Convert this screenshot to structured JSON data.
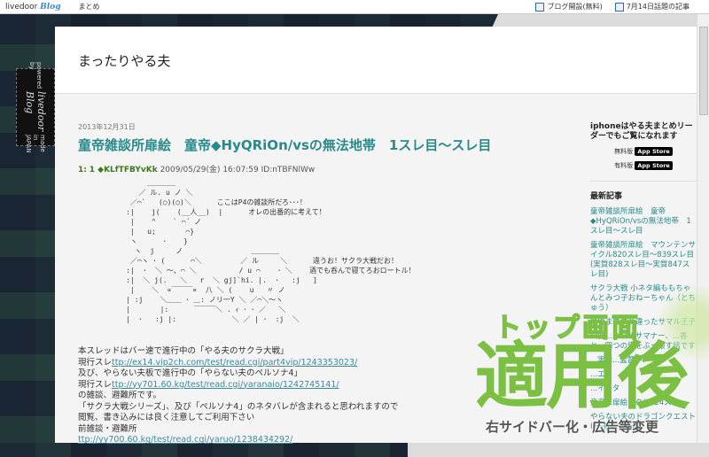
{
  "topbar": {
    "logo": "livedoor",
    "logo_blog": "Blog",
    "matome": "まとめ",
    "blog_open": "ブログ開設(無料)",
    "today": "7月14日話題の記事"
  },
  "tag": {
    "powered": "powered by",
    "brand": "livedoor Blog",
    "made": "made in JAPAN"
  },
  "blog_title": "まったりやる夫",
  "post": {
    "date": "2013年12月31日",
    "title": "童帝雑談所扉絵　童帝◆HyQRiOn/vsの無法地帯　1スレ目～スレ目",
    "meta_num": "1:",
    "meta_name": "1 ◆KLfTFBYvKk",
    "meta_rest": "2009/05/29(金) 16:07:59 ID:nTBFNlWw",
    "aa": "          ＿＿＿＿\n        ／ ル. u ノ ＼\n      ／⌒`   (○)(○)＼      ここはP4の雑談所だろ･･･！\n     :|    j(    (__人__)  |      オレの出番的に考えて！\n      |    ^    ` ⌒´ ノ\n      |   u;       ⌒}\n      ヽ      ･    }\n       ヽ  j     ノ                ＿＿＿＿\n      ／⌒ヽ ･ (      ⌒＼         ／ ル     ＼      違うお！サクラ大戦だお！\n     :|  ･  ＼ ～、⌒ ＼          / u ⌒    ･ ＼    酒でも呑んで寝てろおロートル！\n     :|  ＼ j(.   ＼   r  ＼ gj]`hi. |.  ･   :j   ]\n      |    ＼  ∝￣￣￣∝  八 ＼ (    u   〃 ノ\n     | :j    ＼＿＿ ･ ＿: ノリ一Y ＼ ／⌒＼～ヽ\n     |       |:      ￣￣￣＼ . ｨ ･ ･ ／   ＼\n     |  ･   :j |:             ＼ ／ | ･  :j  ＼",
    "lines": [
      {
        "text": "本スレッドはバー速で進行中の「やる夫のサクラ大戦」"
      },
      {
        "prefix": "現行スレ",
        "link": "ttp://ex14.vip2ch.com/test/read.cgi/part4vip/1243353023/"
      },
      {
        "text": "及び、やらない夫板で進行中の「やらない夫のペルソナ4」"
      },
      {
        "prefix": "現行スレ",
        "link": "ttp://yy701.60.kg/test/read.cgi/yaranaio/1242745141/"
      },
      {
        "text": "の雑談、避難所です。"
      },
      {
        "text": "「サクラ大戦シリーズ」、及び「ペルソナ4」のネタバレが含まれると思われますので"
      },
      {
        "text": "閲覧、書き込みには良く注意してご利用下さい"
      },
      {
        "text": " "
      },
      {
        "text": "前雑談・避難所"
      },
      {
        "link": "ttp://yy700.60.kg/test/read.cgi/yaruo/1238434292/"
      }
    ]
  },
  "sidebar": {
    "iphone": "iphoneはやる夫まとめリーダーでもご覧になれます",
    "free": "無料版",
    "paid": "有料版",
    "appstore": "App Store",
    "recent_title": "最新記事",
    "recent": [
      "童帝雑談所扉絵　童帝◆HyQRiOn/vsの無法地帯　1スレ目～スレ目",
      "童帝雑談所扉絵　マウンテンサイクル820スレ目～839スレ目(実質828スレ目～実質847スレ目)",
      "サクラ大戦 小ネタ編ももちゃんとみつ子おねーちゃん（とちゅう）",
      "最後まですれ違ったサマル王子",
      "公爵...ないルサマナー、...香と...四つの塔をぶっ壊す話です",
      "...実話...監督中～",
      "...エ",
      "...イ...タ",
      "童帝...扉絵...クル824スレ",
      "やらない夫のドラゴンクエストIIーもしも伝説"
    ]
  },
  "overlay": {
    "line1": "トップ画面",
    "line2": "適用後",
    "line3": "右サイドバー化・広告等変更"
  }
}
